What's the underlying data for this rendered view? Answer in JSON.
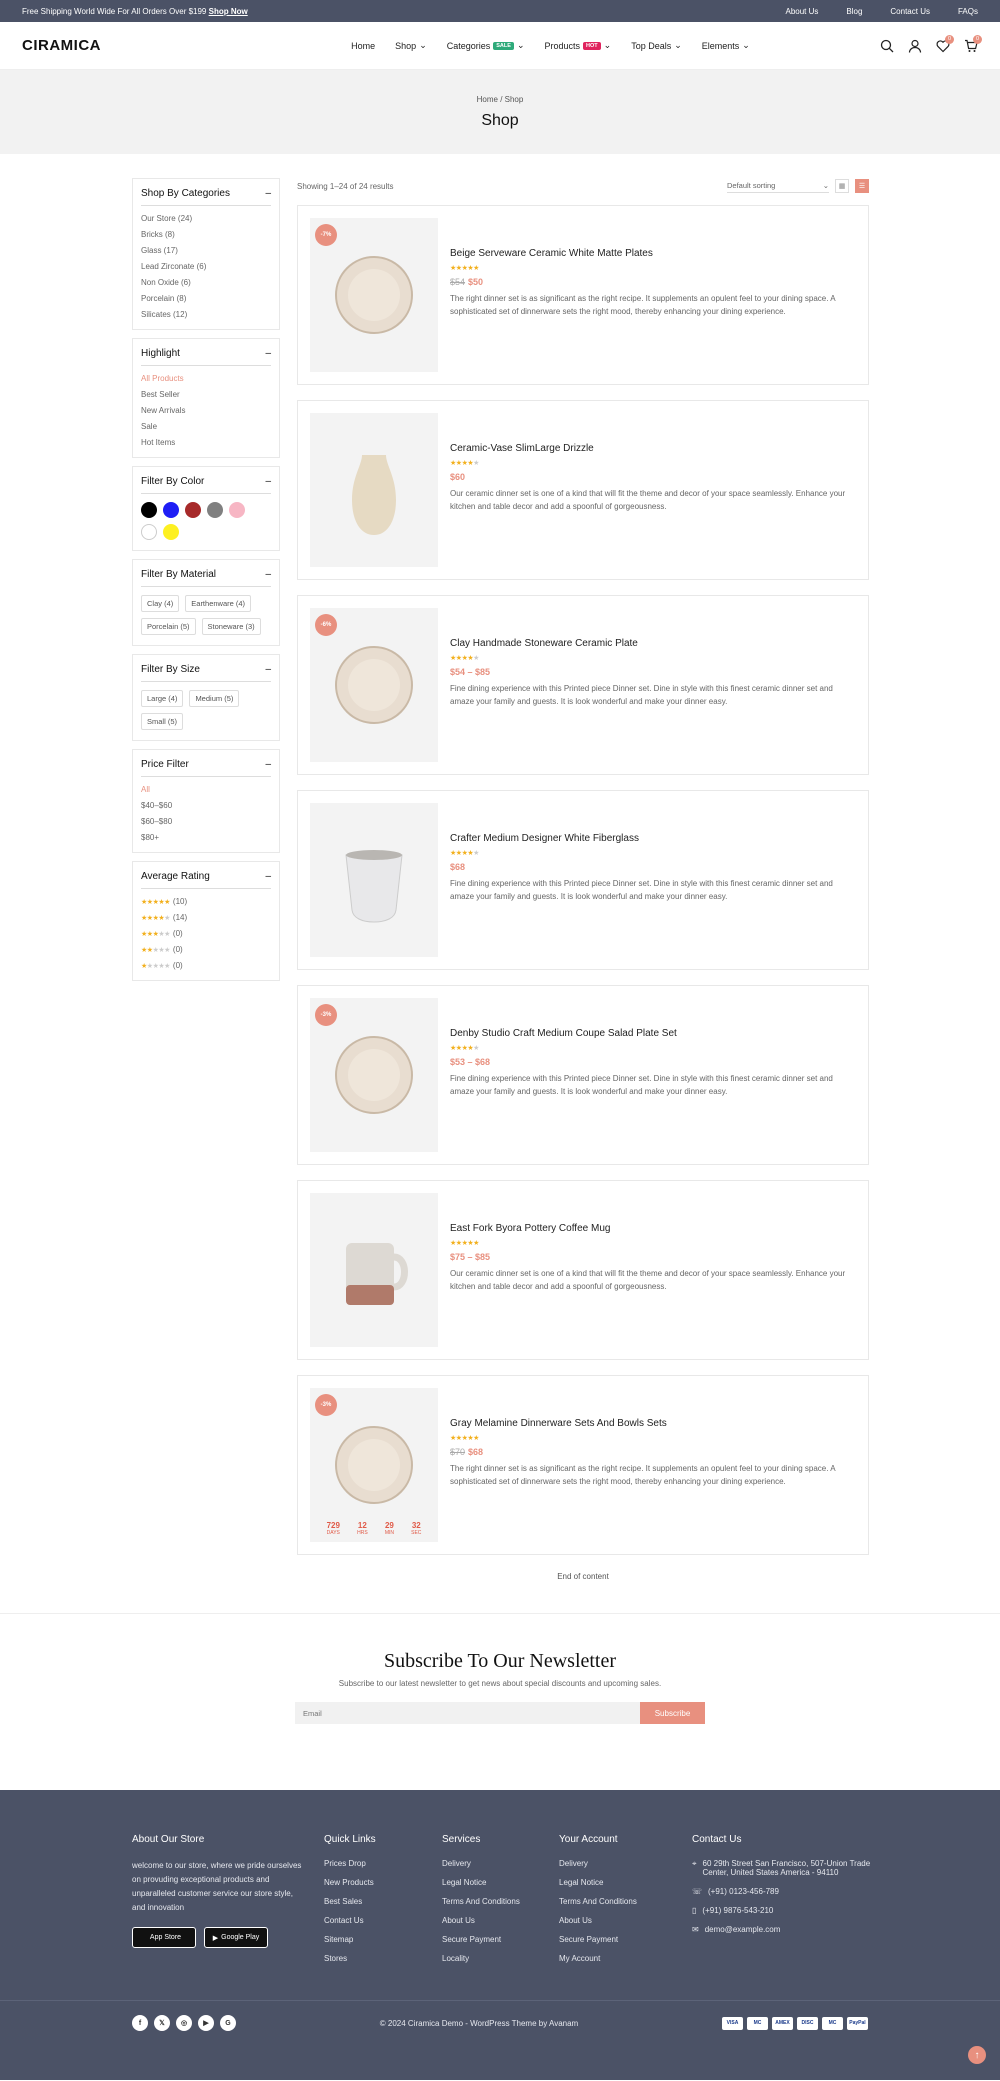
{
  "topbar": {
    "promo": "Free Shipping World Wide For All Orders Over $199",
    "promo_link": "Shop Now",
    "links": [
      "About Us",
      "Blog",
      "Contact Us",
      "FAQs"
    ]
  },
  "header": {
    "logo": "CIRAMICA",
    "nav": [
      {
        "label": "Home"
      },
      {
        "label": "Shop"
      },
      {
        "label": "Categories",
        "badge": "SALE",
        "badge_color": "#2eaa7a"
      },
      {
        "label": "Products",
        "badge": "HOT",
        "badge_color": "#e0245e"
      },
      {
        "label": "Top Deals"
      },
      {
        "label": "Elements"
      }
    ],
    "wishlist_count": "0",
    "cart_count": "0"
  },
  "pagehead": {
    "breadcrumb": "Home / Shop",
    "title": "Shop"
  },
  "sidebar": {
    "categories": {
      "title": "Shop By Categories",
      "items": [
        "Our Store (24)",
        "Bricks (8)",
        "Glass (17)",
        "Lead Zirconate (6)",
        "Non Oxide (6)",
        "Porcelain (8)",
        "Silicates (12)"
      ]
    },
    "highlight": {
      "title": "Highlight",
      "items": [
        "All Products",
        "Best Seller",
        "New Arrivals",
        "Sale",
        "Hot Items"
      ]
    },
    "color": {
      "title": "Filter By Color",
      "colors": [
        "#000000",
        "#1f1ef5",
        "#a72a2a",
        "#808080",
        "#f7b6c4",
        "#ffffff",
        "#fdf021"
      ]
    },
    "material": {
      "title": "Filter By Material",
      "items": [
        "Clay (4)",
        "Earthenware (4)",
        "Porcelain (5)",
        "Stoneware (3)"
      ]
    },
    "size": {
      "title": "Filter By Size",
      "items": [
        "Large (4)",
        "Medium (5)",
        "Small (5)"
      ]
    },
    "price": {
      "title": "Price Filter",
      "items": [
        "All",
        "$40–$60",
        "$60–$80",
        "$80+"
      ]
    },
    "rating": {
      "title": "Average Rating",
      "items": [
        {
          "stars": 5,
          "count": "(10)"
        },
        {
          "stars": 4,
          "count": "(14)"
        },
        {
          "stars": 3,
          "count": "(0)"
        },
        {
          "stars": 2,
          "count": "(0)"
        },
        {
          "stars": 1,
          "count": "(0)"
        }
      ]
    }
  },
  "toolbar": {
    "result_count": "Showing 1–24 of 24 results",
    "sorting": "Default sorting"
  },
  "products": [
    {
      "name": "Beige Serveware Ceramic White Matte Plates",
      "discount": "-7%",
      "old_price": "$54",
      "price": "$50",
      "rating": 5,
      "desc": "The right dinner set is as significant as the right recipe. It supplements an opulent feel to your dining space. A sophisticated set of dinnerware sets the right mood, thereby enhancing your dining experience.",
      "icon": "plate-icon"
    },
    {
      "name": "Ceramic-Vase SlimLarge Drizzle",
      "discount": "",
      "old_price": "",
      "price": "$60",
      "rating": 4,
      "desc": "Our ceramic dinner set is one of a kind that will fit the theme and decor of your space seamlessly. Enhance your kitchen and table decor and add a spoonful of gorgeousness.",
      "icon": "vase-icon"
    },
    {
      "name": "Clay Handmade Stoneware Ceramic Plate",
      "discount": "-6%",
      "old_price": "",
      "price": "$54 – $85",
      "rating": 4,
      "desc": "Fine dining experience with this Printed piece Dinner set. Dine in style with this finest ceramic dinner set and amaze your family and guests. It is look wonderful and make your dinner easy.",
      "icon": "plate-icon"
    },
    {
      "name": "Crafter Medium Designer White Fiberglass",
      "discount": "",
      "old_price": "",
      "price": "$68",
      "rating": 4,
      "desc": "Fine dining experience with this Printed piece Dinner set. Dine in style with this finest ceramic dinner set and amaze your family and guests. It is look wonderful and make your dinner easy.",
      "icon": "cup-icon"
    },
    {
      "name": "Denby Studio Craft Medium Coupe Salad Plate Set",
      "discount": "-3%",
      "old_price": "",
      "price": "$53 – $68",
      "rating": 4,
      "desc": "Fine dining experience with this Printed piece Dinner set. Dine in style with this finest ceramic dinner set and amaze your family and guests. It is look wonderful and make your dinner easy.",
      "icon": "plate-icon"
    },
    {
      "name": "East Fork Byora Pottery Coffee Mug",
      "discount": "",
      "old_price": "",
      "price": "$75 – $85",
      "rating": 5,
      "desc": "Our ceramic dinner set is one of a kind that will fit the theme and decor of your space seamlessly. Enhance your kitchen and table decor and add a spoonful of gorgeousness.",
      "icon": "mug-icon"
    },
    {
      "name": "Gray Melamine Dinnerware Sets And Bowls Sets",
      "discount": "-3%",
      "old_price": "$70",
      "price": "$68",
      "rating": 5,
      "desc": "The right dinner set is as significant as the right recipe. It supplements an opulent feel to your dining space. A sophisticated set of dinnerware sets the right mood, thereby enhancing your dining experience.",
      "icon": "plate-icon",
      "countdown": [
        {
          "v": "729",
          "l": "DAYS"
        },
        {
          "v": "12",
          "l": "HRS"
        },
        {
          "v": "29",
          "l": "MIN"
        },
        {
          "v": "32",
          "l": "SEC"
        }
      ]
    }
  ],
  "end_text": "End of content",
  "newsletter": {
    "title": "Subscribe To Our Newsletter",
    "subtitle": "Subscribe to our latest newsletter to get news about special discounts and upcoming sales.",
    "placeholder": "Email",
    "button": "Subscribe"
  },
  "footer": {
    "about_title": "About Our Store",
    "about_text": "welcome to our store, where we pride ourselves on provuding exceptional products and unparalleled customer service our store style, and innovation",
    "app_store": "App Store",
    "google_play": "Google Play",
    "quick_title": "Quick Links",
    "quick": [
      "Prices Drop",
      "New Products",
      "Best Sales",
      "Contact Us",
      "Sitemap",
      "Stores"
    ],
    "services_title": "Services",
    "services": [
      "Delivery",
      "Legal Notice",
      "Terms And Conditions",
      "About Us",
      "Secure Payment",
      "Locality"
    ],
    "account_title": "Your Account",
    "account": [
      "Delivery",
      "Legal Notice",
      "Terms And Conditions",
      "About Us",
      "Secure Payment",
      "My Account"
    ],
    "contact_title": "Contact Us",
    "contact": [
      "60 29th Street San Francisco, 507-Union Trade Center, United States America - 94110",
      "(+91) 0123-456-789",
      "(+91) 9876-543-210",
      "demo@example.com"
    ],
    "copyright": "© 2024 Ciramica Demo - WordPress Theme by Avanam",
    "payments": [
      "VISA",
      "MC",
      "AMEX",
      "DISC",
      "MC",
      "PayPal"
    ]
  }
}
